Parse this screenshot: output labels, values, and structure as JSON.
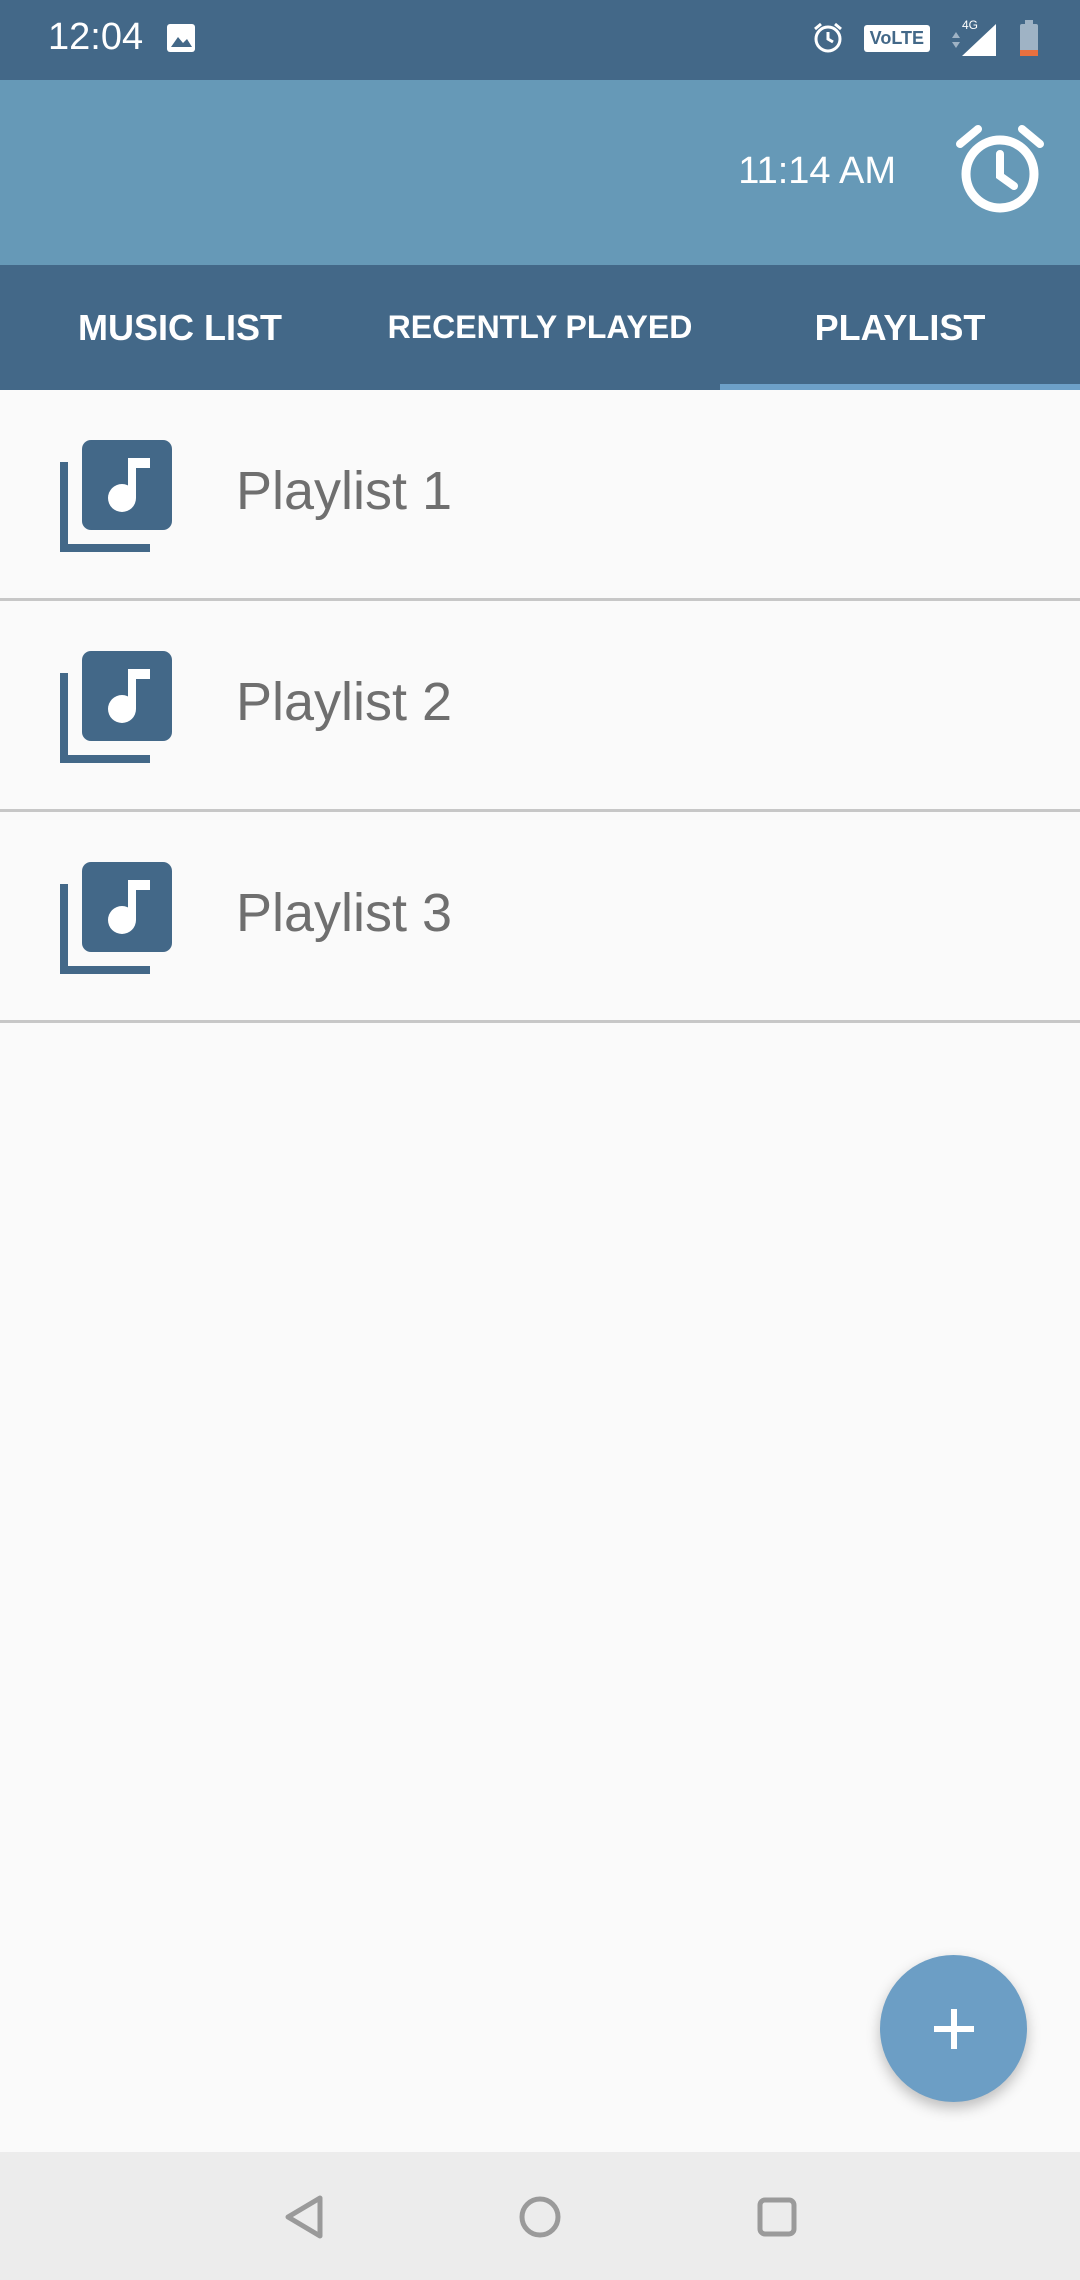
{
  "status_bar": {
    "time": "12:04",
    "icons": [
      "image-icon",
      "alarm-icon",
      "volte-icon",
      "signal-icon",
      "battery-icon"
    ],
    "volte_label": "VoLTE",
    "network_label": "4G"
  },
  "app_bar": {
    "alarm_time": "11:14 AM",
    "alarm_icon": "alarm-clock-icon"
  },
  "tabs": [
    {
      "label": "MUSIC LIST",
      "active": false
    },
    {
      "label": "RECENTLY PLAYED",
      "active": false
    },
    {
      "label": "PLAYLIST",
      "active": true
    }
  ],
  "playlists": [
    {
      "label": "Playlist 1",
      "icon": "library-music-icon"
    },
    {
      "label": "Playlist 2",
      "icon": "library-music-icon"
    },
    {
      "label": "Playlist 3",
      "icon": "library-music-icon"
    }
  ],
  "fab": {
    "icon": "plus-icon"
  },
  "nav_bar": {
    "buttons": [
      "back-icon",
      "home-icon",
      "recents-icon"
    ]
  },
  "colors": {
    "primary_dark": "#436888",
    "primary": "#6699b7",
    "accent": "#6c9ec5",
    "text_secondary": "#6f6f6f"
  }
}
